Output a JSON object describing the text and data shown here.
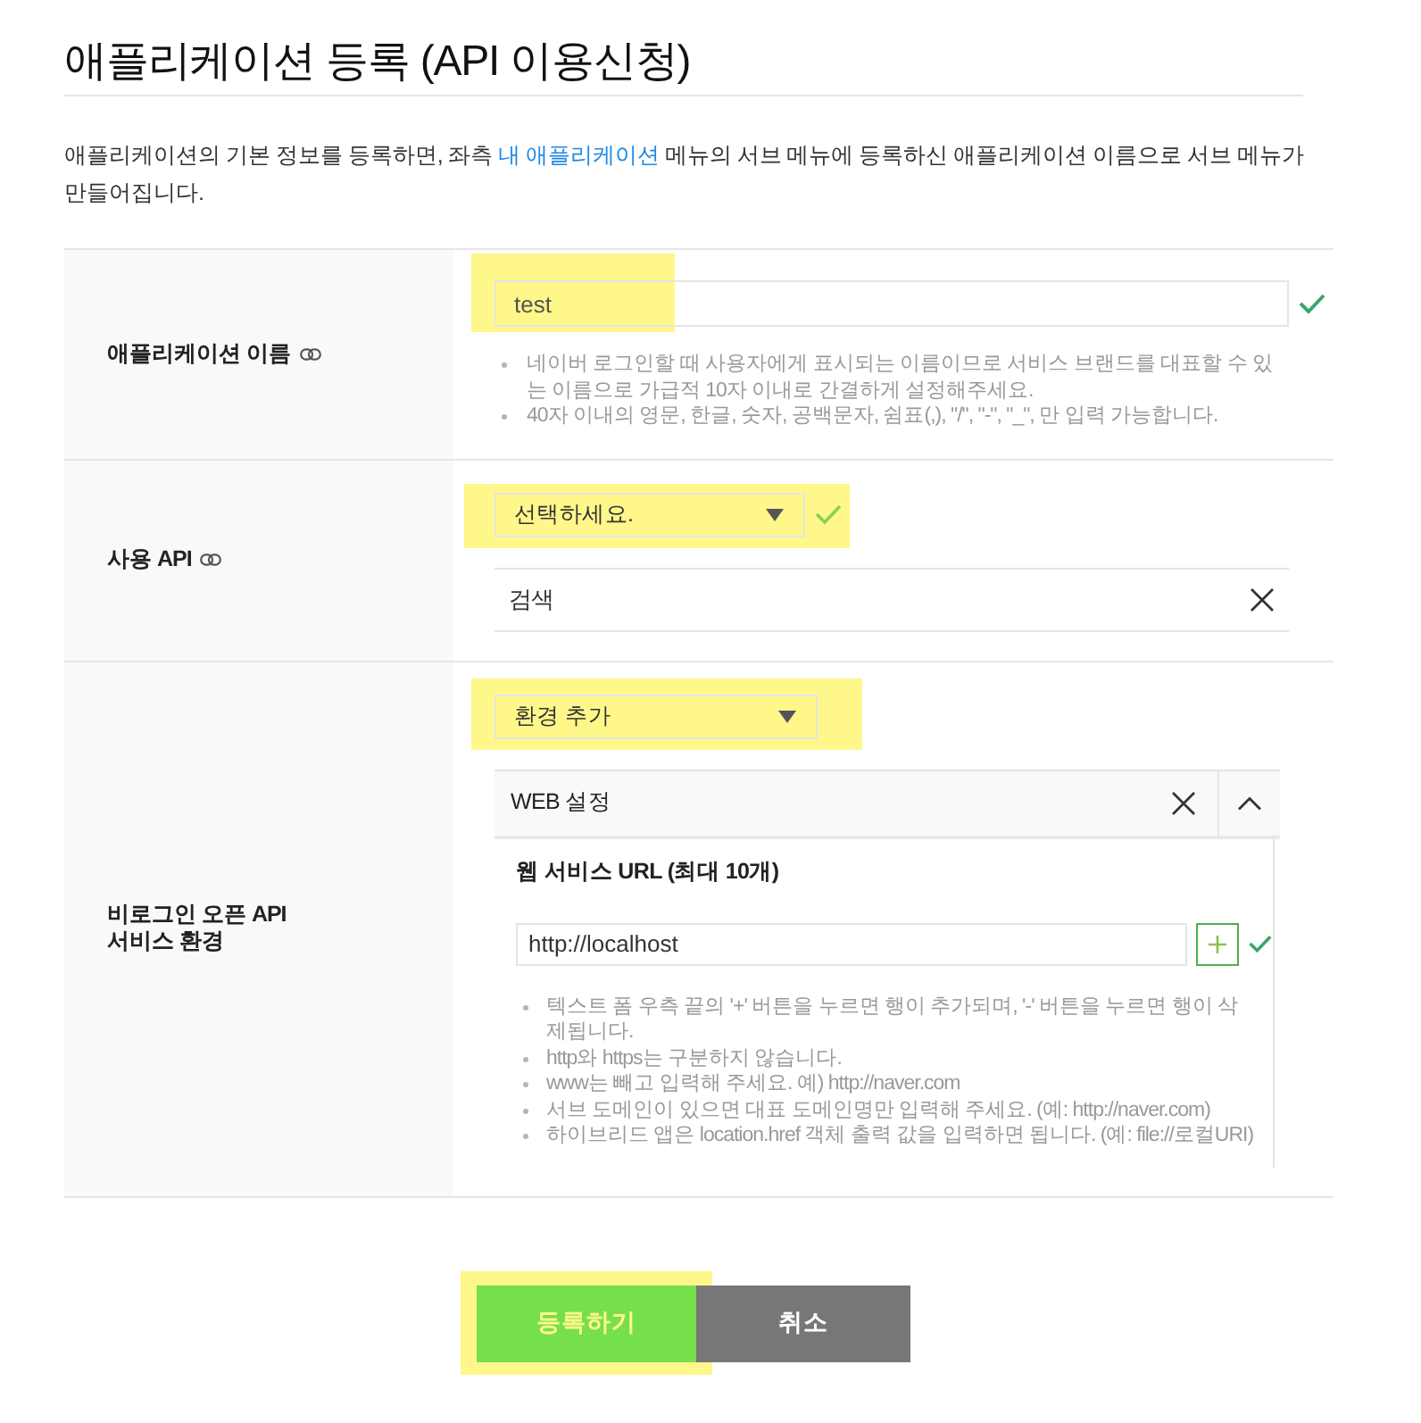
{
  "page": {
    "title": "애플리케이션 등록 (API 이용신청)",
    "intro": {
      "before": "애플리케이션의 기본 정보를 등록하면, 좌측 ",
      "link": "내 애플리케이션",
      "after": " 메뉴의 서브 메뉴에 등록하신 애플리케이션 이름으로 서브 메뉴가 만들어집니다."
    }
  },
  "form": {
    "rows": [
      {
        "kind": "text",
        "label": "애플리케이션 이름",
        "linked": true,
        "field": {
          "value": "test",
          "valid": true,
          "highlighted": true
        },
        "notes": [
          "네이버 로그인할 때 사용자에게 표시되는 이름이므로 서비스 브랜드를 대표할 수 있는 이름으로 가급적 10자 이내로 간결하게 설정해주세요.",
          "40자 이내의 영문, 한글, 숫자, 공백문자, 쉼표(,), \"/\", \"-\", \"_\", 만 입력 가능합니다."
        ]
      },
      {
        "kind": "api",
        "label": "사용 API",
        "linked": true,
        "select": {
          "value": "선택하세요.",
          "valid": true,
          "highlighted": true
        },
        "apis": [
          {
            "name": "검색"
          }
        ]
      },
      {
        "kind": "environment",
        "label": "비로그인 오픈 API\n서비스 환경",
        "linked": false,
        "select": {
          "value": "환경 추가",
          "valid": false,
          "highlighted": true
        },
        "panels": [
          {
            "title": "WEB 설정",
            "expanded": true,
            "field_label": "웹 서비스 URL (최대 10개)",
            "urls": [
              {
                "value": "http://localhost",
                "valid": true
              }
            ],
            "notes": [
              "텍스트 폼 우측 끝의 '+' 버튼을 누르면 행이 추가되며, '-' 버튼을 누르면 행이 삭제됩니다.",
              "http와 https는 구분하지 않습니다.",
              "www는 빼고 입력해 주세요. 예) http://naver.com",
              "서브 도메인이 있으면 대표 도메인명만 입력해 주세요. (예: http://naver.com)",
              "하이브리드 앱은 location.href 객체 출력 값을 입력하면 됩니다. (예: file://로컬URI)"
            ]
          }
        ]
      }
    ]
  },
  "buttons": [
    {
      "kind": "primary",
      "label": "등록하기",
      "highlighted": true
    },
    {
      "kind": "secondary",
      "label": "취소",
      "highlighted": false
    }
  ]
}
